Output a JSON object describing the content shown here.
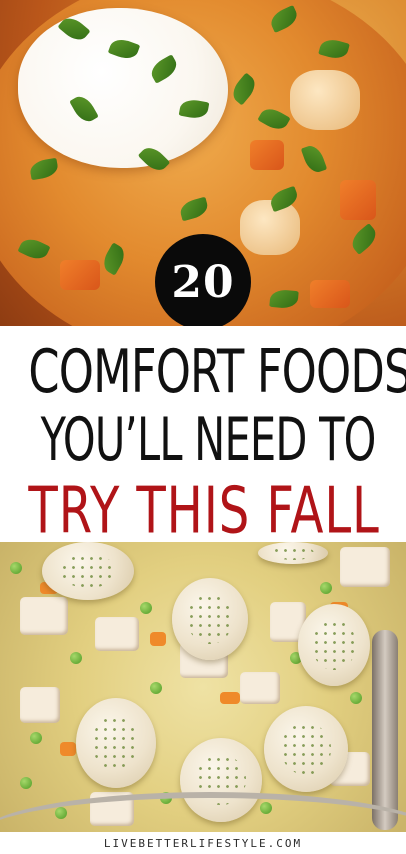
{
  "badge": {
    "number": "20"
  },
  "title": {
    "line1": "COMFORT FOODS",
    "line2": "YOU’LL NEED TO",
    "line3": "TRY THIS FALL"
  },
  "footer": {
    "site": "LIVEBETTERLIFESTYLE.COM"
  },
  "colors": {
    "title_dark": "#111111",
    "title_accent": "#b01418",
    "badge_bg": "#0a0a0a"
  }
}
